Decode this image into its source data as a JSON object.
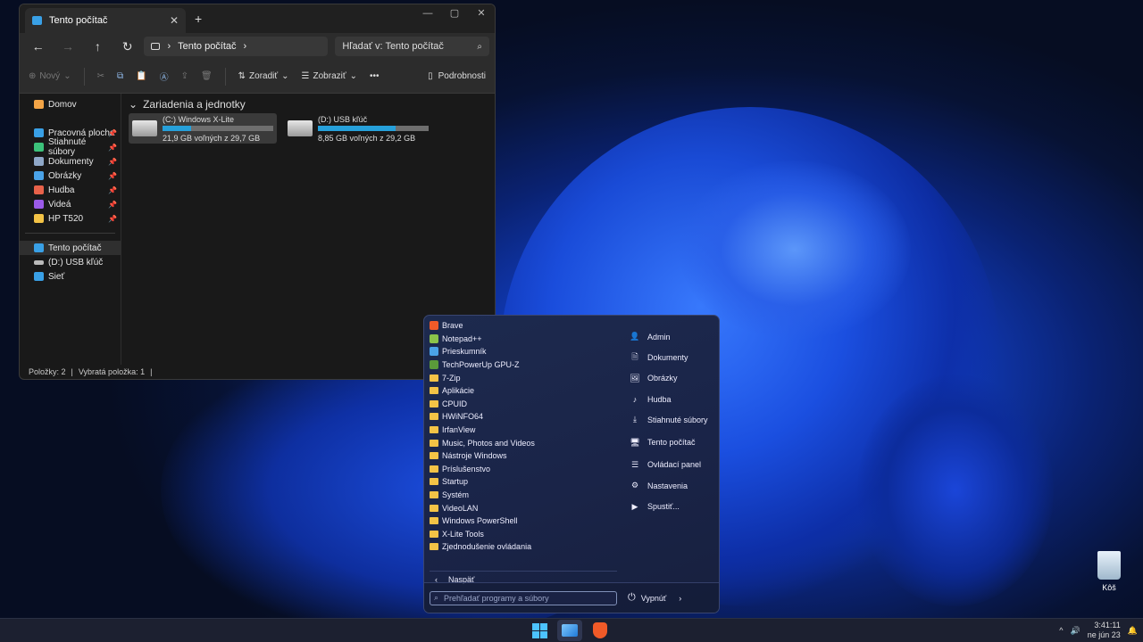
{
  "explorer": {
    "tab_title": "Tento počítač",
    "tab_close": "✕",
    "tab_add": "+",
    "window_controls": {
      "minimize": "—",
      "maximize": "▢",
      "close": "✕"
    },
    "nav": {
      "back": "←",
      "forward": "→",
      "up": "↑",
      "refresh": "↻"
    },
    "address": {
      "sep": "›",
      "location": "Tento počítač",
      "chevron": "›"
    },
    "search_placeholder": "Hľadať v: Tento počítač",
    "toolbar": {
      "new_label": "Nový",
      "sort_label": "Zoradiť",
      "view_label": "Zobraziť",
      "more_label": "•••",
      "details_label": "Podrobnosti"
    },
    "sidebar": {
      "home": "Domov",
      "pinned": [
        {
          "label": "Pracovná plocha",
          "color": "#39a0e6"
        },
        {
          "label": "Stiahnuté súbory",
          "color": "#3cc27a"
        },
        {
          "label": "Dokumenty",
          "color": "#8fa8c8"
        },
        {
          "label": "Obrázky",
          "color": "#4aa3e8"
        },
        {
          "label": "Hudba",
          "color": "#e8624a"
        },
        {
          "label": "Videá",
          "color": "#9a5ae8"
        },
        {
          "label": "HP T520",
          "color": "#f3c346"
        }
      ],
      "pin_glyph": "📌",
      "this_pc": "Tento počítač",
      "usb": "(D:) USB kľúč",
      "network": "Sieť"
    },
    "group_header": "Zariadenia a jednotky",
    "drives": [
      {
        "name": "(C:) Windows X-Lite",
        "free": "21,9 GB voľných z 29,7 GB",
        "used_fraction": 0.26
      },
      {
        "name": "(D:) USB kľúč",
        "free": "8,85 GB voľných z 29,2 GB",
        "used_fraction": 0.7
      }
    ],
    "status": {
      "items": "Položky: 2",
      "selected": "Vybratá položka: 1",
      "sep": "|"
    }
  },
  "start_menu": {
    "programs": [
      {
        "label": "Brave",
        "icon": "brave",
        "color": "#f05a28"
      },
      {
        "label": "Notepad++",
        "icon": "notepad",
        "color": "#8bc34a"
      },
      {
        "label": "Prieskumník",
        "icon": "explorer",
        "color": "#4aa3e8"
      },
      {
        "label": "TechPowerUp GPU-Z",
        "icon": "gpuz",
        "color": "#5a9a3a"
      },
      {
        "label": "7-Zip",
        "icon": "folder"
      },
      {
        "label": "Aplikácie",
        "icon": "folder"
      },
      {
        "label": "CPUID",
        "icon": "folder"
      },
      {
        "label": "HWiNFO64",
        "icon": "folder"
      },
      {
        "label": "IrfanView",
        "icon": "folder"
      },
      {
        "label": "Music, Photos and Videos",
        "icon": "folder"
      },
      {
        "label": "Nástroje Windows",
        "icon": "folder"
      },
      {
        "label": "Príslušenstvo",
        "icon": "folder"
      },
      {
        "label": "Startup",
        "icon": "folder"
      },
      {
        "label": "Systém",
        "icon": "folder"
      },
      {
        "label": "VideoLAN",
        "icon": "folder"
      },
      {
        "label": "Windows PowerShell",
        "icon": "folder"
      },
      {
        "label": "X-Lite Tools",
        "icon": "folder"
      },
      {
        "label": "Zjednodušenie ovládania",
        "icon": "folder"
      }
    ],
    "back_arrow": "‹",
    "back_label": "Naspäť",
    "right_links": [
      {
        "label": "Admin",
        "icon": "user-icon",
        "glyph": "👤"
      },
      {
        "label": "Dokumenty",
        "icon": "document-icon",
        "glyph": "🗎"
      },
      {
        "label": "Obrázky",
        "icon": "picture-icon",
        "glyph": "🖼"
      },
      {
        "label": "Hudba",
        "icon": "music-icon",
        "glyph": "♪"
      },
      {
        "label": "Stiahnuté súbory",
        "icon": "download-icon",
        "glyph": "⤓"
      },
      {
        "label": "Tento počítač",
        "icon": "computer-icon",
        "glyph": "🖥"
      },
      {
        "label": "Ovládací panel",
        "icon": "control-panel-icon",
        "glyph": "☰"
      },
      {
        "label": "Nastavenia",
        "icon": "gear-icon",
        "glyph": "⚙"
      },
      {
        "label": "Spustiť...",
        "icon": "run-icon",
        "glyph": "▶"
      }
    ],
    "search_placeholder": "Prehľadať programy a súbory",
    "power_label": "Vypnúť",
    "power_glyph": "⏻",
    "power_chevron": "›"
  },
  "desktop": {
    "recycle_bin": "Kôš"
  },
  "taskbar": {
    "time": "3:41:11",
    "date": "ne jún 23",
    "tray_chevron": "^",
    "volume_glyph": "🔊",
    "notify_glyph": "🔔"
  }
}
